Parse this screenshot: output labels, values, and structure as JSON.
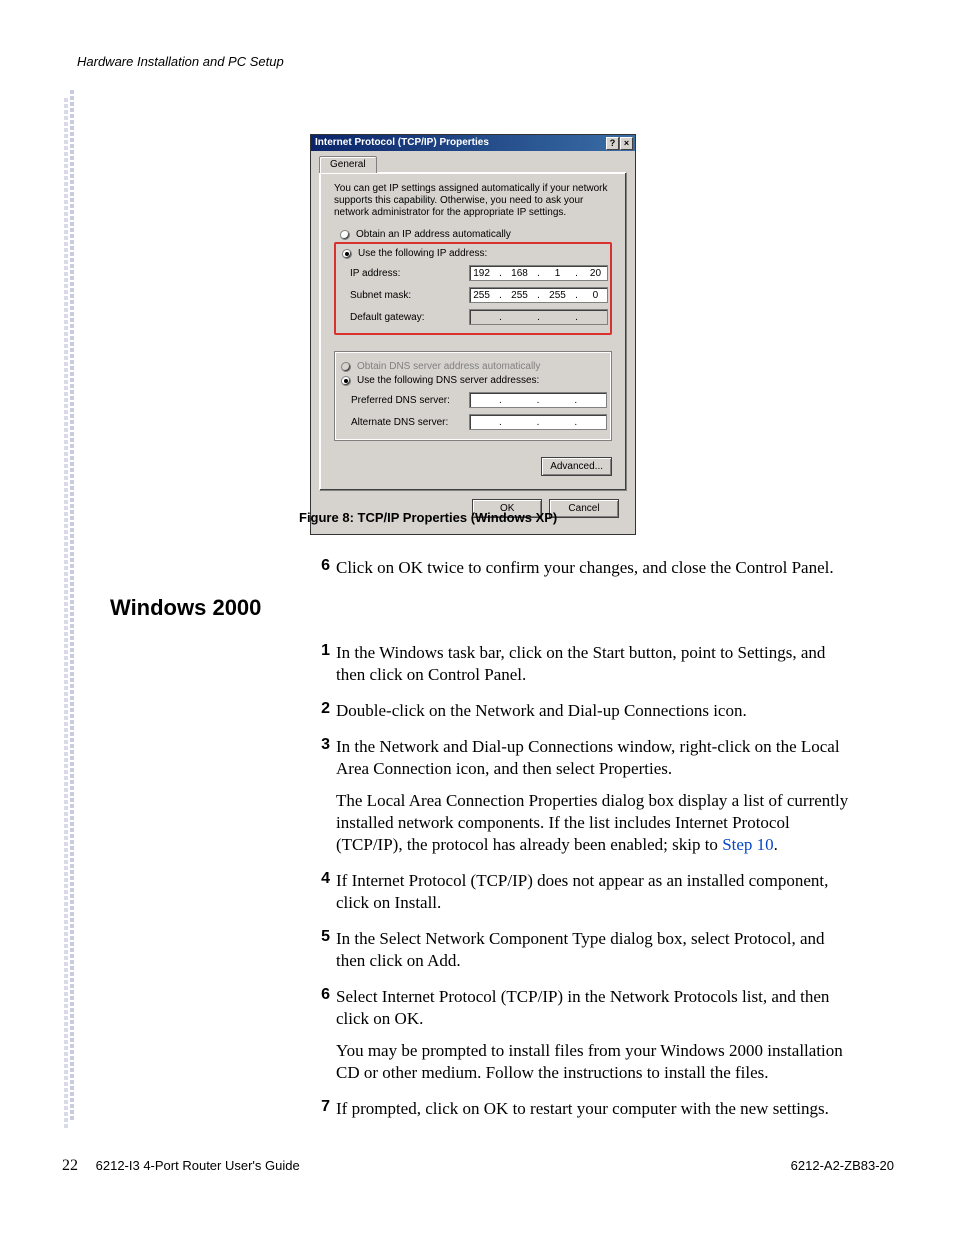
{
  "header": {
    "title": "Hardware Installation and PC Setup"
  },
  "dialog": {
    "title": "Internet Protocol (TCP/IP) Properties",
    "help_btn": "?",
    "close_btn": "×",
    "tab": "General",
    "intro": "You can get IP settings assigned automatically if your network supports this capability. Otherwise, you need to ask your network administrator for the appropriate IP settings.",
    "radio_auto_ip": "Obtain an IP address automatically",
    "radio_manual_ip": "Use the following IP address:",
    "labels": {
      "ip": "IP address:",
      "subnet": "Subnet mask:",
      "gateway": "Default gateway:",
      "pref_dns": "Preferred DNS server:",
      "alt_dns": "Alternate DNS server:"
    },
    "ip": {
      "a": "192",
      "b": "168",
      "c": "1",
      "d": "20"
    },
    "subnet": {
      "a": "255",
      "b": "255",
      "c": "255",
      "d": "0"
    },
    "radio_auto_dns": "Obtain DNS server address automatically",
    "radio_manual_dns": "Use the following DNS server addresses:",
    "advanced_btn": "Advanced...",
    "ok_btn": "OK",
    "cancel_btn": "Cancel"
  },
  "caption": "Figure 8: TCP/IP Properties (Windows XP)",
  "section2_title": "Windows 2000",
  "steps_a": [
    {
      "num": "6",
      "text": "Click on OK  twice to confirm your changes, and close the Control Panel."
    }
  ],
  "steps_b": [
    {
      "num": "1",
      "text": "In the Windows task bar, click on the Start button, point to Settings, and then click on Control Panel."
    },
    {
      "num": "2",
      "text": "Double-click on the Network and Dial-up Connections icon."
    },
    {
      "num": "3",
      "text": "In the Network and Dial-up Connections window, right-click on the Local Area Connection icon, and then select Properties.",
      "para": "The Local Area Connection Properties dialog box display a list of currently installed network components. If the list includes Internet Protocol (TCP/IP), the protocol has already been enabled; skip to ",
      "link": "Step 10",
      "after_link": "."
    },
    {
      "num": "4",
      "text": "If Internet Protocol (TCP/IP) does not appear as an installed component, click on Install."
    },
    {
      "num": "5",
      "text": "In the Select Network Component Type dialog box, select Protocol, and then click on Add."
    },
    {
      "num": "6",
      "text": "Select Internet Protocol (TCP/IP) in the Network Protocols list, and then click on OK.",
      "para": "You may be prompted to install files from your Windows 2000 installation CD or other medium. Follow the instructions to install the files."
    },
    {
      "num": "7",
      "text": "If prompted, click on OK to restart your computer with the new settings."
    }
  ],
  "footer": {
    "page_num": "22",
    "doc_title": "6212-I3 4-Port Router User's Guide",
    "doc_code": "6212-A2-ZB83-20"
  }
}
